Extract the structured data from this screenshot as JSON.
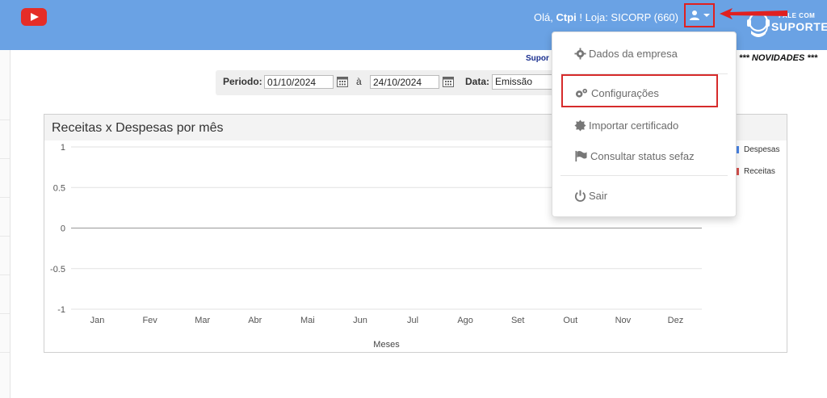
{
  "header": {
    "greeting_prefix": "Olá, ",
    "user_name": "Ctpi",
    "greeting_suffix": " !  Loja: SICORP (660)",
    "support_line1": "FALE COM",
    "support_line2": "SUPORTE"
  },
  "news": {
    "support_link": "Supor",
    "novidades": "*** NOVIDADES ***"
  },
  "filters": {
    "periodo_label": "Periodo:",
    "date_from": "01/10/2024",
    "separator": "à",
    "date_to": "24/10/2024",
    "data_label": "Data:",
    "data_selected": "Emissão"
  },
  "chart_title": "Receitas x Despesas por mês",
  "chart_data": {
    "type": "line",
    "categories": [
      "Jan",
      "Fev",
      "Mar",
      "Abr",
      "Mai",
      "Jun",
      "Jul",
      "Ago",
      "Set",
      "Out",
      "Nov",
      "Dez"
    ],
    "y_ticks": [
      "1",
      "0.5",
      "0",
      "-0.5",
      "-1"
    ],
    "ylim": [
      -1,
      1
    ],
    "xlabel": "Meses",
    "ylabel": "",
    "grid": true,
    "legend_position": "right",
    "series": [
      {
        "name": "Despesas",
        "color": "#4a86e8",
        "values": []
      },
      {
        "name": "Receitas",
        "color": "#d9534f",
        "values": []
      }
    ]
  },
  "menu": {
    "items": [
      {
        "label": "Dados da empresa",
        "icon": "gear-icon"
      },
      {
        "label": "Configurações",
        "icon": "gears-icon"
      },
      {
        "label": "Importar certificado",
        "icon": "certificate-icon"
      },
      {
        "label": "Consultar status sefaz",
        "icon": "flag-icon"
      },
      {
        "label": "Sair",
        "icon": "power-icon"
      }
    ]
  },
  "colors": {
    "header_bg": "#6aa2e4",
    "highlight": "#d62b2b"
  }
}
